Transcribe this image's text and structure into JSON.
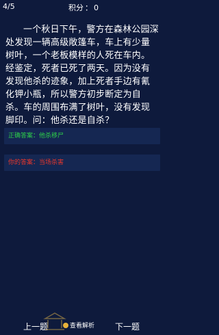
{
  "header": {
    "progress": "4/5",
    "score_label": "积分",
    "score_sep": "：",
    "score_value": "0"
  },
  "question": {
    "text": "一个秋日下午，警方在森林公园深处发现一辆高级敞篷车，车上有少量树叶，一个老板模样的人死在车内。经鉴定，死者已死了两天。因为没有发现他杀的迹象，加上死者手边有氰化钾小瓶，所以警方初步断定为自杀。车的周围布满了树叶，没有发现脚印。问：他杀还是自杀？"
  },
  "answers": {
    "correct_label": "正确答案：他杀移尸",
    "mine_label": "你的答案：当场杀害"
  },
  "footer": {
    "prev_label": "上一题",
    "analysis_label": "查看解析",
    "next_label": "下一题"
  },
  "colors": {
    "background": "#0e1a3c",
    "answer_box": "#152752",
    "correct": "#2ecf4a",
    "wrong": "#e8372c",
    "accent": "#e8b23a"
  },
  "icons": {
    "analysis": "magnifier-icon",
    "watermark": "temple-logo"
  }
}
